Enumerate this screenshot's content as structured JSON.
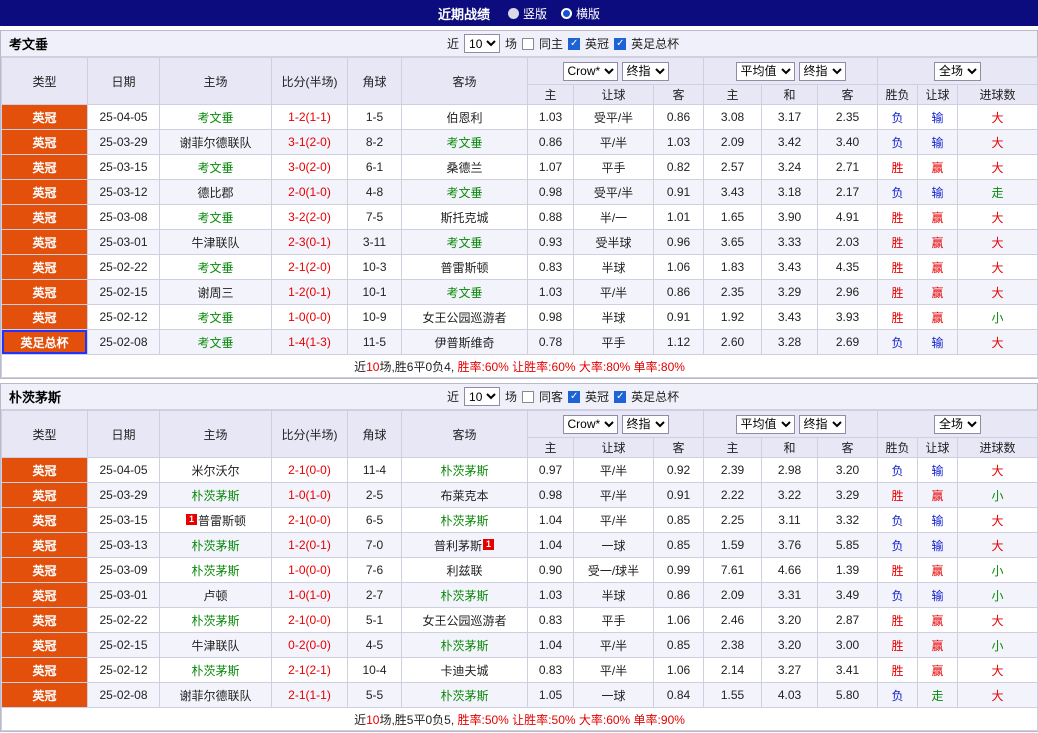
{
  "top_bar": {
    "title": "近期战绩",
    "view_options": [
      {
        "label": "竖版",
        "selected": false
      },
      {
        "label": "横版",
        "selected": true
      }
    ]
  },
  "filter": {
    "near": "近",
    "count": "10",
    "games": "场",
    "same_checked": false,
    "league1": "英冠",
    "league1_checked": true,
    "league2": "英足总杯",
    "league2_checked": true
  },
  "table_header": {
    "type": "类型",
    "date": "日期",
    "home": "主场",
    "score": "比分(半场)",
    "corner": "角球",
    "away": "客场",
    "odds_dropdowns": {
      "company": "Crow*",
      "final1": "终指",
      "average": "平均值",
      "final2": "终指",
      "fulltime": "全场"
    },
    "sub_columns": [
      "主",
      "让球",
      "客",
      "主",
      "和",
      "客",
      "胜负",
      "让球",
      "进球数"
    ]
  },
  "colors": {
    "top_bar_bg": "#0c0c7e",
    "header_bg": "#e7e7f6",
    "league_badge_bg": "#e2500c",
    "cup_border_blue": "#2033ff",
    "win_red": "#e60000",
    "loss_blue": "#0f1ecc",
    "push_green": "#0a8a0a",
    "focus_team_green": "#0a8a0a",
    "checkbox_blue": "#1e63d6",
    "alt_row_bg": "#f3f3fb"
  },
  "sections": [
    {
      "team": "考文垂",
      "same_label": "同主",
      "rows": [
        {
          "league": "英冠",
          "cup": false,
          "date": "25-04-05",
          "home": "考文垂",
          "home_focus": true,
          "score": "1-2(1-1)",
          "corner": "1-5",
          "away": "伯恩利",
          "away_focus": false,
          "odds": [
            "1.03",
            "受平/半",
            "0.86",
            "3.08",
            "3.17",
            "2.35"
          ],
          "result": "负",
          "result_color": "blue",
          "handicap": "输",
          "handicap_color": "blue",
          "goals": "大",
          "goals_color": "red"
        },
        {
          "league": "英冠",
          "cup": false,
          "date": "25-03-29",
          "home": "谢菲尔德联队",
          "home_focus": false,
          "score": "3-1(2-0)",
          "corner": "8-2",
          "away": "考文垂",
          "away_focus": true,
          "odds": [
            "0.86",
            "平/半",
            "1.03",
            "2.09",
            "3.42",
            "3.40"
          ],
          "result": "负",
          "result_color": "blue",
          "handicap": "输",
          "handicap_color": "blue",
          "goals": "大",
          "goals_color": "red"
        },
        {
          "league": "英冠",
          "cup": false,
          "date": "25-03-15",
          "home": "考文垂",
          "home_focus": true,
          "score": "3-0(2-0)",
          "corner": "6-1",
          "away": "桑德兰",
          "away_focus": false,
          "odds": [
            "1.07",
            "平手",
            "0.82",
            "2.57",
            "3.24",
            "2.71"
          ],
          "result": "胜",
          "result_color": "red",
          "handicap": "赢",
          "handicap_color": "red",
          "goals": "大",
          "goals_color": "red"
        },
        {
          "league": "英冠",
          "cup": false,
          "date": "25-03-12",
          "home": "德比郡",
          "home_focus": false,
          "score": "2-0(1-0)",
          "corner": "4-8",
          "away": "考文垂",
          "away_focus": true,
          "odds": [
            "0.98",
            "受平/半",
            "0.91",
            "3.43",
            "3.18",
            "2.17"
          ],
          "result": "负",
          "result_color": "blue",
          "handicap": "输",
          "handicap_color": "blue",
          "goals": "走",
          "goals_color": "green"
        },
        {
          "league": "英冠",
          "cup": false,
          "date": "25-03-08",
          "home": "考文垂",
          "home_focus": true,
          "score": "3-2(2-0)",
          "corner": "7-5",
          "away": "斯托克城",
          "away_focus": false,
          "odds": [
            "0.88",
            "半/一",
            "1.01",
            "1.65",
            "3.90",
            "4.91"
          ],
          "result": "胜",
          "result_color": "red",
          "handicap": "赢",
          "handicap_color": "red",
          "goals": "大",
          "goals_color": "red"
        },
        {
          "league": "英冠",
          "cup": false,
          "date": "25-03-01",
          "home": "牛津联队",
          "home_focus": false,
          "score": "2-3(0-1)",
          "corner": "3-11",
          "away": "考文垂",
          "away_focus": true,
          "odds": [
            "0.93",
            "受半球",
            "0.96",
            "3.65",
            "3.33",
            "2.03"
          ],
          "result": "胜",
          "result_color": "red",
          "handicap": "赢",
          "handicap_color": "red",
          "goals": "大",
          "goals_color": "red"
        },
        {
          "league": "英冠",
          "cup": false,
          "date": "25-02-22",
          "home": "考文垂",
          "home_focus": true,
          "score": "2-1(2-0)",
          "corner": "10-3",
          "away": "普雷斯顿",
          "away_focus": false,
          "odds": [
            "0.83",
            "半球",
            "1.06",
            "1.83",
            "3.43",
            "4.35"
          ],
          "result": "胜",
          "result_color": "red",
          "handicap": "赢",
          "handicap_color": "red",
          "goals": "大",
          "goals_color": "red"
        },
        {
          "league": "英冠",
          "cup": false,
          "date": "25-02-15",
          "home": "谢周三",
          "home_focus": false,
          "score": "1-2(0-1)",
          "corner": "10-1",
          "away": "考文垂",
          "away_focus": true,
          "odds": [
            "1.03",
            "平/半",
            "0.86",
            "2.35",
            "3.29",
            "2.96"
          ],
          "result": "胜",
          "result_color": "red",
          "handicap": "赢",
          "handicap_color": "red",
          "goals": "大",
          "goals_color": "red"
        },
        {
          "league": "英冠",
          "cup": false,
          "date": "25-02-12",
          "home": "考文垂",
          "home_focus": true,
          "score": "1-0(0-0)",
          "corner": "10-9",
          "away": "女王公园巡游者",
          "away_focus": false,
          "odds": [
            "0.98",
            "半球",
            "0.91",
            "1.92",
            "3.43",
            "3.93"
          ],
          "result": "胜",
          "result_color": "red",
          "handicap": "赢",
          "handicap_color": "red",
          "goals": "小",
          "goals_color": "green"
        },
        {
          "league": "英足总杯",
          "cup": true,
          "date": "25-02-08",
          "home": "考文垂",
          "home_focus": true,
          "score": "1-4(1-3)",
          "corner": "11-5",
          "away": "伊普斯维奇",
          "away_focus": false,
          "odds": [
            "0.78",
            "平手",
            "1.12",
            "2.60",
            "3.28",
            "2.69"
          ],
          "result": "负",
          "result_color": "blue",
          "handicap": "输",
          "handicap_color": "blue",
          "goals": "大",
          "goals_color": "red"
        }
      ],
      "summary": [
        {
          "text": "近",
          "color": "dark"
        },
        {
          "text": "10",
          "color": "red"
        },
        {
          "text": "场,胜6平0负4, ",
          "color": "dark"
        },
        {
          "text": "胜率:60% 让胜率:60% 大率:80% 单率:80%",
          "color": "red"
        }
      ]
    },
    {
      "team": "朴茨茅斯",
      "same_label": "同客",
      "rows": [
        {
          "league": "英冠",
          "cup": false,
          "date": "25-04-05",
          "home": "米尔沃尔",
          "home_focus": false,
          "score": "2-1(0-0)",
          "corner": "11-4",
          "away": "朴茨茅斯",
          "away_focus": true,
          "odds": [
            "0.97",
            "平/半",
            "0.92",
            "2.39",
            "2.98",
            "3.20"
          ],
          "result": "负",
          "result_color": "blue",
          "handicap": "输",
          "handicap_color": "blue",
          "goals": "大",
          "goals_color": "red"
        },
        {
          "league": "英冠",
          "cup": false,
          "date": "25-03-29",
          "home": "朴茨茅斯",
          "home_focus": true,
          "score": "1-0(1-0)",
          "corner": "2-5",
          "away": "布莱克本",
          "away_focus": false,
          "odds": [
            "0.98",
            "平/半",
            "0.91",
            "2.22",
            "3.22",
            "3.29"
          ],
          "result": "胜",
          "result_color": "red",
          "handicap": "赢",
          "handicap_color": "red",
          "goals": "小",
          "goals_color": "green"
        },
        {
          "league": "英冠",
          "cup": false,
          "date": "25-03-15",
          "home": "普雷斯顿",
          "home_focus": false,
          "home_card": "1",
          "home_card_pos": "before",
          "score": "2-1(0-0)",
          "corner": "6-5",
          "away": "朴茨茅斯",
          "away_focus": true,
          "odds": [
            "1.04",
            "平/半",
            "0.85",
            "2.25",
            "3.11",
            "3.32"
          ],
          "result": "负",
          "result_color": "blue",
          "handicap": "输",
          "handicap_color": "blue",
          "goals": "大",
          "goals_color": "red"
        },
        {
          "league": "英冠",
          "cup": false,
          "date": "25-03-13",
          "home": "朴茨茅斯",
          "home_focus": true,
          "score": "1-2(0-1)",
          "corner": "7-0",
          "away": "普利茅斯",
          "away_focus": false,
          "away_card": "1",
          "away_card_pos": "after",
          "odds": [
            "1.04",
            "一球",
            "0.85",
            "1.59",
            "3.76",
            "5.85"
          ],
          "result": "负",
          "result_color": "blue",
          "handicap": "输",
          "handicap_color": "blue",
          "goals": "大",
          "goals_color": "red"
        },
        {
          "league": "英冠",
          "cup": false,
          "date": "25-03-09",
          "home": "朴茨茅斯",
          "home_focus": true,
          "score": "1-0(0-0)",
          "corner": "7-6",
          "away": "利兹联",
          "away_focus": false,
          "odds": [
            "0.90",
            "受一/球半",
            "0.99",
            "7.61",
            "4.66",
            "1.39"
          ],
          "result": "胜",
          "result_color": "red",
          "handicap": "赢",
          "handicap_color": "red",
          "goals": "小",
          "goals_color": "green"
        },
        {
          "league": "英冠",
          "cup": false,
          "date": "25-03-01",
          "home": "卢顿",
          "home_focus": false,
          "score": "1-0(1-0)",
          "corner": "2-7",
          "away": "朴茨茅斯",
          "away_focus": true,
          "odds": [
            "1.03",
            "半球",
            "0.86",
            "2.09",
            "3.31",
            "3.49"
          ],
          "result": "负",
          "result_color": "blue",
          "handicap": "输",
          "handicap_color": "blue",
          "goals": "小",
          "goals_color": "green"
        },
        {
          "league": "英冠",
          "cup": false,
          "date": "25-02-22",
          "home": "朴茨茅斯",
          "home_focus": true,
          "score": "2-1(0-0)",
          "corner": "5-1",
          "away": "女王公园巡游者",
          "away_focus": false,
          "odds": [
            "0.83",
            "平手",
            "1.06",
            "2.46",
            "3.20",
            "2.87"
          ],
          "result": "胜",
          "result_color": "red",
          "handicap": "赢",
          "handicap_color": "red",
          "goals": "大",
          "goals_color": "red"
        },
        {
          "league": "英冠",
          "cup": false,
          "date": "25-02-15",
          "home": "牛津联队",
          "home_focus": false,
          "score": "0-2(0-0)",
          "corner": "4-5",
          "away": "朴茨茅斯",
          "away_focus": true,
          "odds": [
            "1.04",
            "平/半",
            "0.85",
            "2.38",
            "3.20",
            "3.00"
          ],
          "result": "胜",
          "result_color": "red",
          "handicap": "赢",
          "handicap_color": "red",
          "goals": "小",
          "goals_color": "green"
        },
        {
          "league": "英冠",
          "cup": false,
          "date": "25-02-12",
          "home": "朴茨茅斯",
          "home_focus": true,
          "score": "2-1(2-1)",
          "corner": "10-4",
          "away": "卡迪夫城",
          "away_focus": false,
          "odds": [
            "0.83",
            "平/半",
            "1.06",
            "2.14",
            "3.27",
            "3.41"
          ],
          "result": "胜",
          "result_color": "red",
          "handicap": "赢",
          "handicap_color": "red",
          "goals": "大",
          "goals_color": "red"
        },
        {
          "league": "英冠",
          "cup": false,
          "date": "25-02-08",
          "home": "谢菲尔德联队",
          "home_focus": false,
          "score": "2-1(1-1)",
          "corner": "5-5",
          "away": "朴茨茅斯",
          "away_focus": true,
          "odds": [
            "1.05",
            "一球",
            "0.84",
            "1.55",
            "4.03",
            "5.80"
          ],
          "result": "负",
          "result_color": "blue",
          "handicap": "走",
          "handicap_color": "green",
          "goals": "大",
          "goals_color": "red"
        }
      ],
      "summary": [
        {
          "text": "近",
          "color": "dark"
        },
        {
          "text": "10",
          "color": "red"
        },
        {
          "text": "场,胜5平0负5, ",
          "color": "dark"
        },
        {
          "text": "胜率:50% 让胜率:50% 大率:60% 单率:90%",
          "color": "red"
        }
      ]
    }
  ]
}
